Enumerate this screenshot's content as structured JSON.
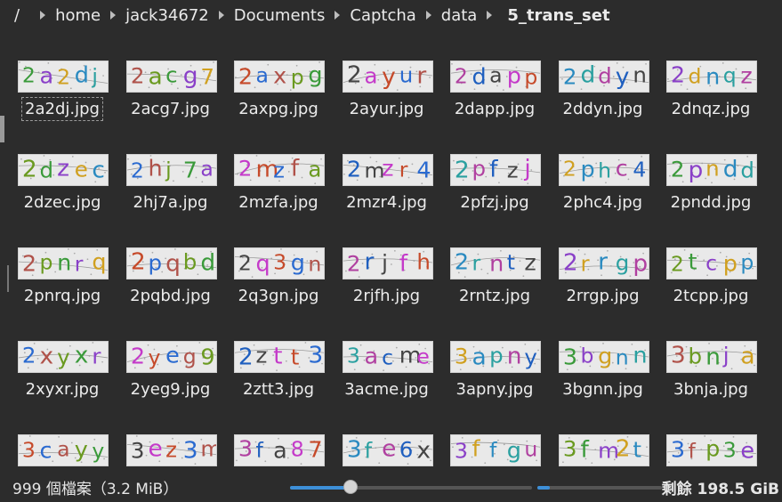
{
  "breadcrumb": {
    "root": "/",
    "items": [
      "home",
      "jack34672",
      "Documents",
      "Captcha",
      "data"
    ],
    "current": "5_trans_set"
  },
  "files": [
    {
      "name": "2a2dj.jpg",
      "text": "2a2dj"
    },
    {
      "name": "2acg7.jpg",
      "text": "2acg7"
    },
    {
      "name": "2axpg.jpg",
      "text": "2axpg"
    },
    {
      "name": "2ayur.jpg",
      "text": "2ayur"
    },
    {
      "name": "2dapp.jpg",
      "text": "2dapp"
    },
    {
      "name": "2ddyn.jpg",
      "text": "2ddyn"
    },
    {
      "name": "2dnqz.jpg",
      "text": "2dnqz"
    },
    {
      "name": "2dzec.jpg",
      "text": "2dzec"
    },
    {
      "name": "2hj7a.jpg",
      "text": "2hj7a"
    },
    {
      "name": "2mzfa.jpg",
      "text": "2mzfa"
    },
    {
      "name": "2mzr4.jpg",
      "text": "2mzr4"
    },
    {
      "name": "2pfzj.jpg",
      "text": "2pfzj"
    },
    {
      "name": "2phc4.jpg",
      "text": "2phc4"
    },
    {
      "name": "2pndd.jpg",
      "text": "2pndd"
    },
    {
      "name": "2pnrq.jpg",
      "text": "2pnrq"
    },
    {
      "name": "2pqbd.jpg",
      "text": "2pqbd"
    },
    {
      "name": "2q3gn.jpg",
      "text": "2q3gn"
    },
    {
      "name": "2rjfh.jpg",
      "text": "2rjfh"
    },
    {
      "name": "2rntz.jpg",
      "text": "2rntz"
    },
    {
      "name": "2rrgp.jpg",
      "text": "2rrgp"
    },
    {
      "name": "2tcpp.jpg",
      "text": "2tcpp"
    },
    {
      "name": "2xyxr.jpg",
      "text": "2xyxr"
    },
    {
      "name": "2yeg9.jpg",
      "text": "2yeg9"
    },
    {
      "name": "2ztt3.jpg",
      "text": "2ztt3"
    },
    {
      "name": "3acme.jpg",
      "text": "3acme"
    },
    {
      "name": "3apny.jpg",
      "text": "3apny"
    },
    {
      "name": "3bgnn.jpg",
      "text": "3bgnn"
    },
    {
      "name": "3bnja.jpg",
      "text": "3bnja"
    },
    {
      "name": "",
      "text": "3cayy"
    },
    {
      "name": "",
      "text": "3ez3m"
    },
    {
      "name": "",
      "text": "3fa87"
    },
    {
      "name": "",
      "text": "3fe6x"
    },
    {
      "name": "",
      "text": "3ffgu"
    },
    {
      "name": "",
      "text": "3fm2t"
    },
    {
      "name": "",
      "text": "3fp3e"
    }
  ],
  "focused_index": 0,
  "status": {
    "count_text": "999 個檔案（3.2 MiB）",
    "zoom_level": 0.25,
    "disk_used_fraction": 0.1,
    "free_text": "剩餘 198.5 GiB"
  },
  "colors": {
    "background": "#2c2c2c",
    "accent": "#3d8fd8",
    "glyph_palette": [
      "#3a9a3a",
      "#c43ac9",
      "#2a8ac0",
      "#b0524a",
      "#1f5fbf",
      "#8a40c8",
      "#c64a2a",
      "#2aa0a0",
      "#6a9a20",
      "#444444",
      "#d0a020",
      "#2a6ad0",
      "#b040a0"
    ]
  }
}
